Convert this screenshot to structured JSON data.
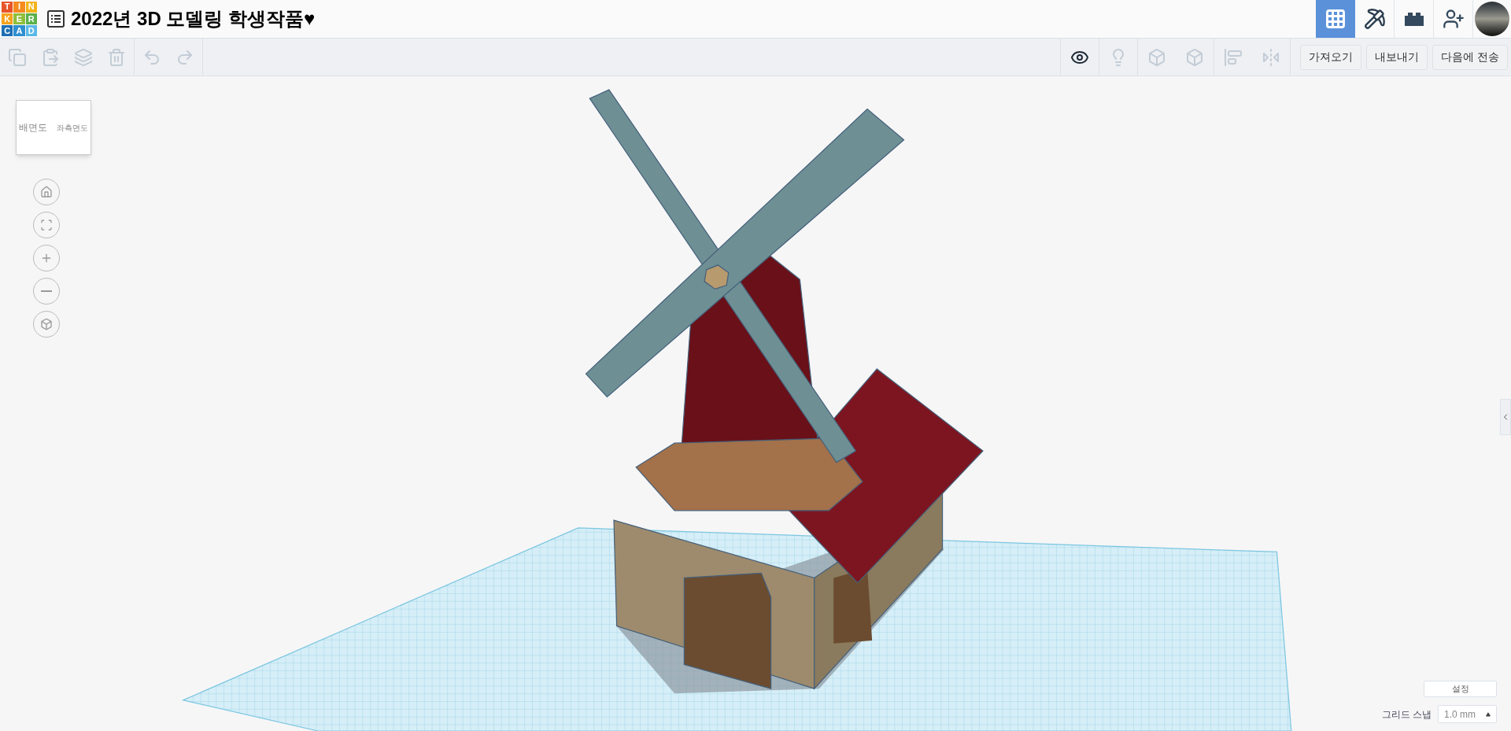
{
  "logo": {
    "letters": [
      {
        "char": "T",
        "color": "#e8542a"
      },
      {
        "char": "I",
        "color": "#f58a1f"
      },
      {
        "char": "N",
        "color": "#f4b41a"
      },
      {
        "char": "K",
        "color": "#f7a21b"
      },
      {
        "char": "E",
        "color": "#8fbf3a"
      },
      {
        "char": "R",
        "color": "#5bb04a"
      },
      {
        "char": "C",
        "color": "#1f6fb5"
      },
      {
        "char": "A",
        "color": "#2f8fd0"
      },
      {
        "char": "D",
        "color": "#5bb8e8"
      }
    ]
  },
  "title": "2022년 3D 모델링 학생작품♥",
  "toolbar": {
    "buttons": [
      "가져오기",
      "내보내기",
      "다음에 전송"
    ]
  },
  "view_cube": {
    "faces": [
      "배면도",
      "좌측면도"
    ]
  },
  "grid_settings": {
    "settings_button": "설정",
    "snap_label": "그리드 스냅",
    "snap_value": "1.0 mm"
  }
}
